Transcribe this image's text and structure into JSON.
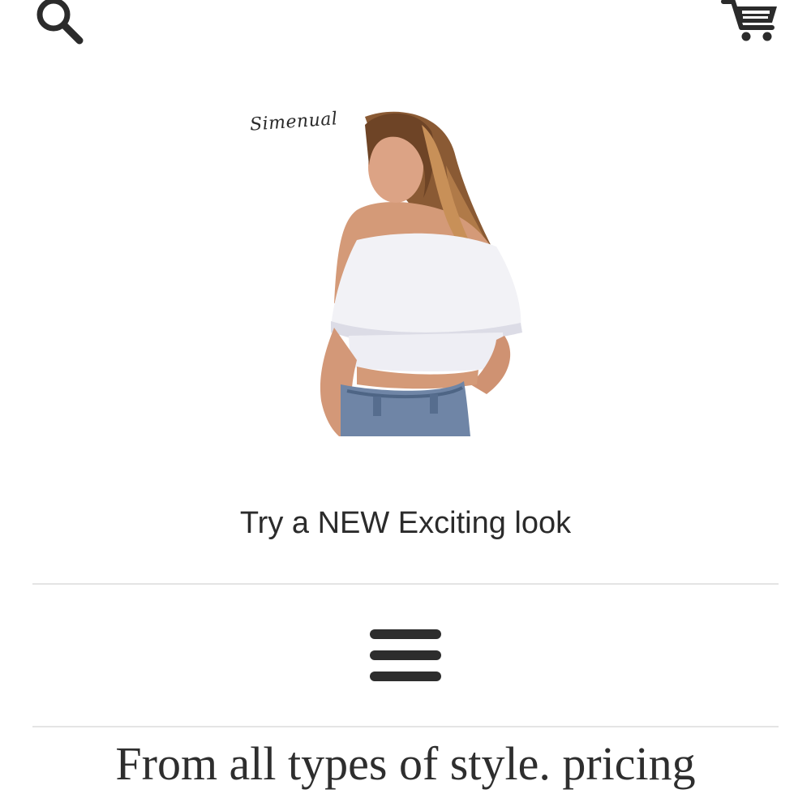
{
  "header": {
    "search_icon": "search-icon",
    "cart_icon": "cart-icon"
  },
  "hero": {
    "brand": "Simenual"
  },
  "tagline": "Try a NEW Exciting look",
  "menu": {
    "icon": "hamburger-menu-icon"
  },
  "headline": "From all types of style. pricing",
  "colors": {
    "text": "#2b2b2b",
    "divider": "#e4e4e4",
    "background": "#ffffff"
  }
}
